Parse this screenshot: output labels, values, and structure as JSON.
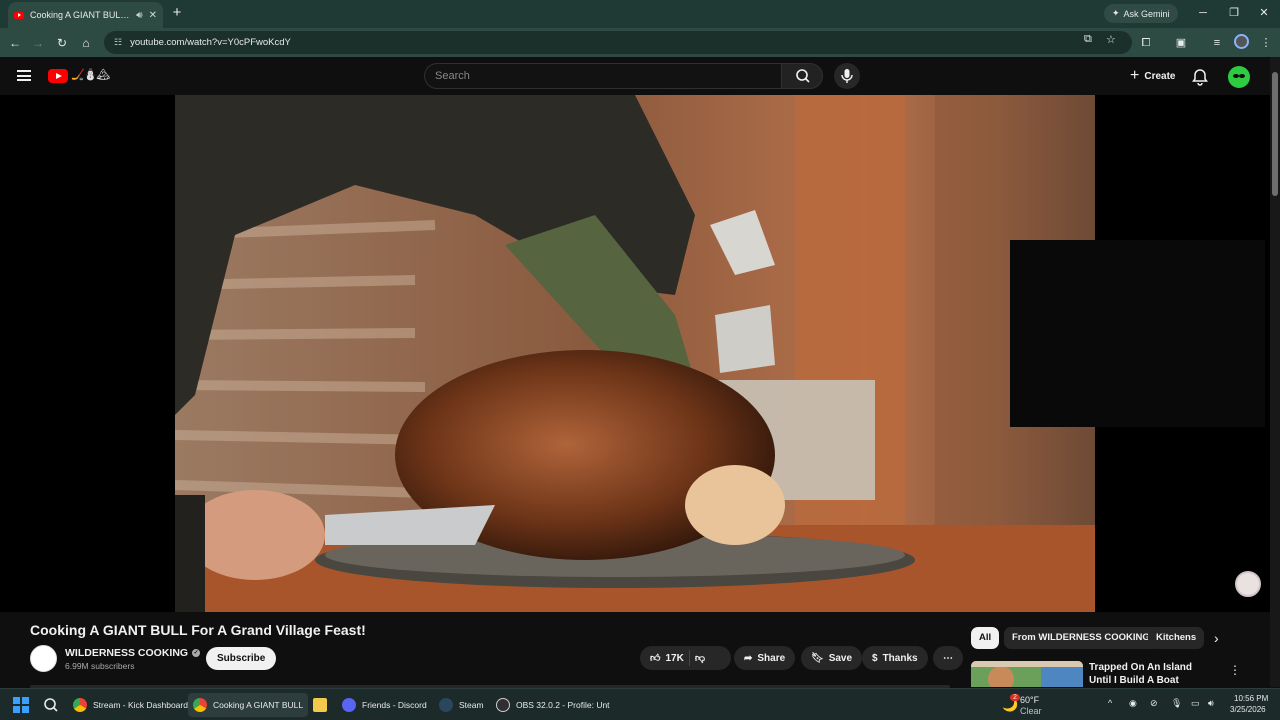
{
  "browser": {
    "tab_title": "Cooking A GIANT BULL For",
    "gemini_label": "Ask Gemini",
    "url": "youtube.com/watch?v=Y0cPFwoKcdY"
  },
  "youtube": {
    "search_placeholder": "Search",
    "create_label": "Create"
  },
  "video": {
    "title": "Cooking A GIANT BULL For A Grand Village Feast!",
    "channel": "WILDERNESS COOKING",
    "subscribers": "6.99M subscribers",
    "subscribe_label": "Subscribe",
    "likes": "17K",
    "share_label": "Share",
    "save_label": "Save",
    "thanks_label": "Thanks"
  },
  "chips": [
    "All",
    "From WILDERNESS COOKING",
    "Kitchens"
  ],
  "recommended": {
    "title": "Trapped On An Island Until I Build A Boat"
  },
  "taskbar": {
    "items": [
      {
        "label": "Stream - Kick Dashboard",
        "color": "#4285f4"
      },
      {
        "label": "Cooking A GIANT BULL",
        "color": "#4285f4"
      },
      {
        "label": "",
        "color": "#f2c94c"
      },
      {
        "label": "Friends - Discord",
        "color": "#5865f2"
      },
      {
        "label": "Steam",
        "color": "#1b2838"
      },
      {
        "label": "OBS 32.0.2 - Profile: Unt",
        "color": "#302e31"
      }
    ],
    "weather_temp": "60°F",
    "weather_desc": "Clear",
    "weather_badge": "2",
    "time": "10:56 PM",
    "date": "3/25/2026"
  }
}
